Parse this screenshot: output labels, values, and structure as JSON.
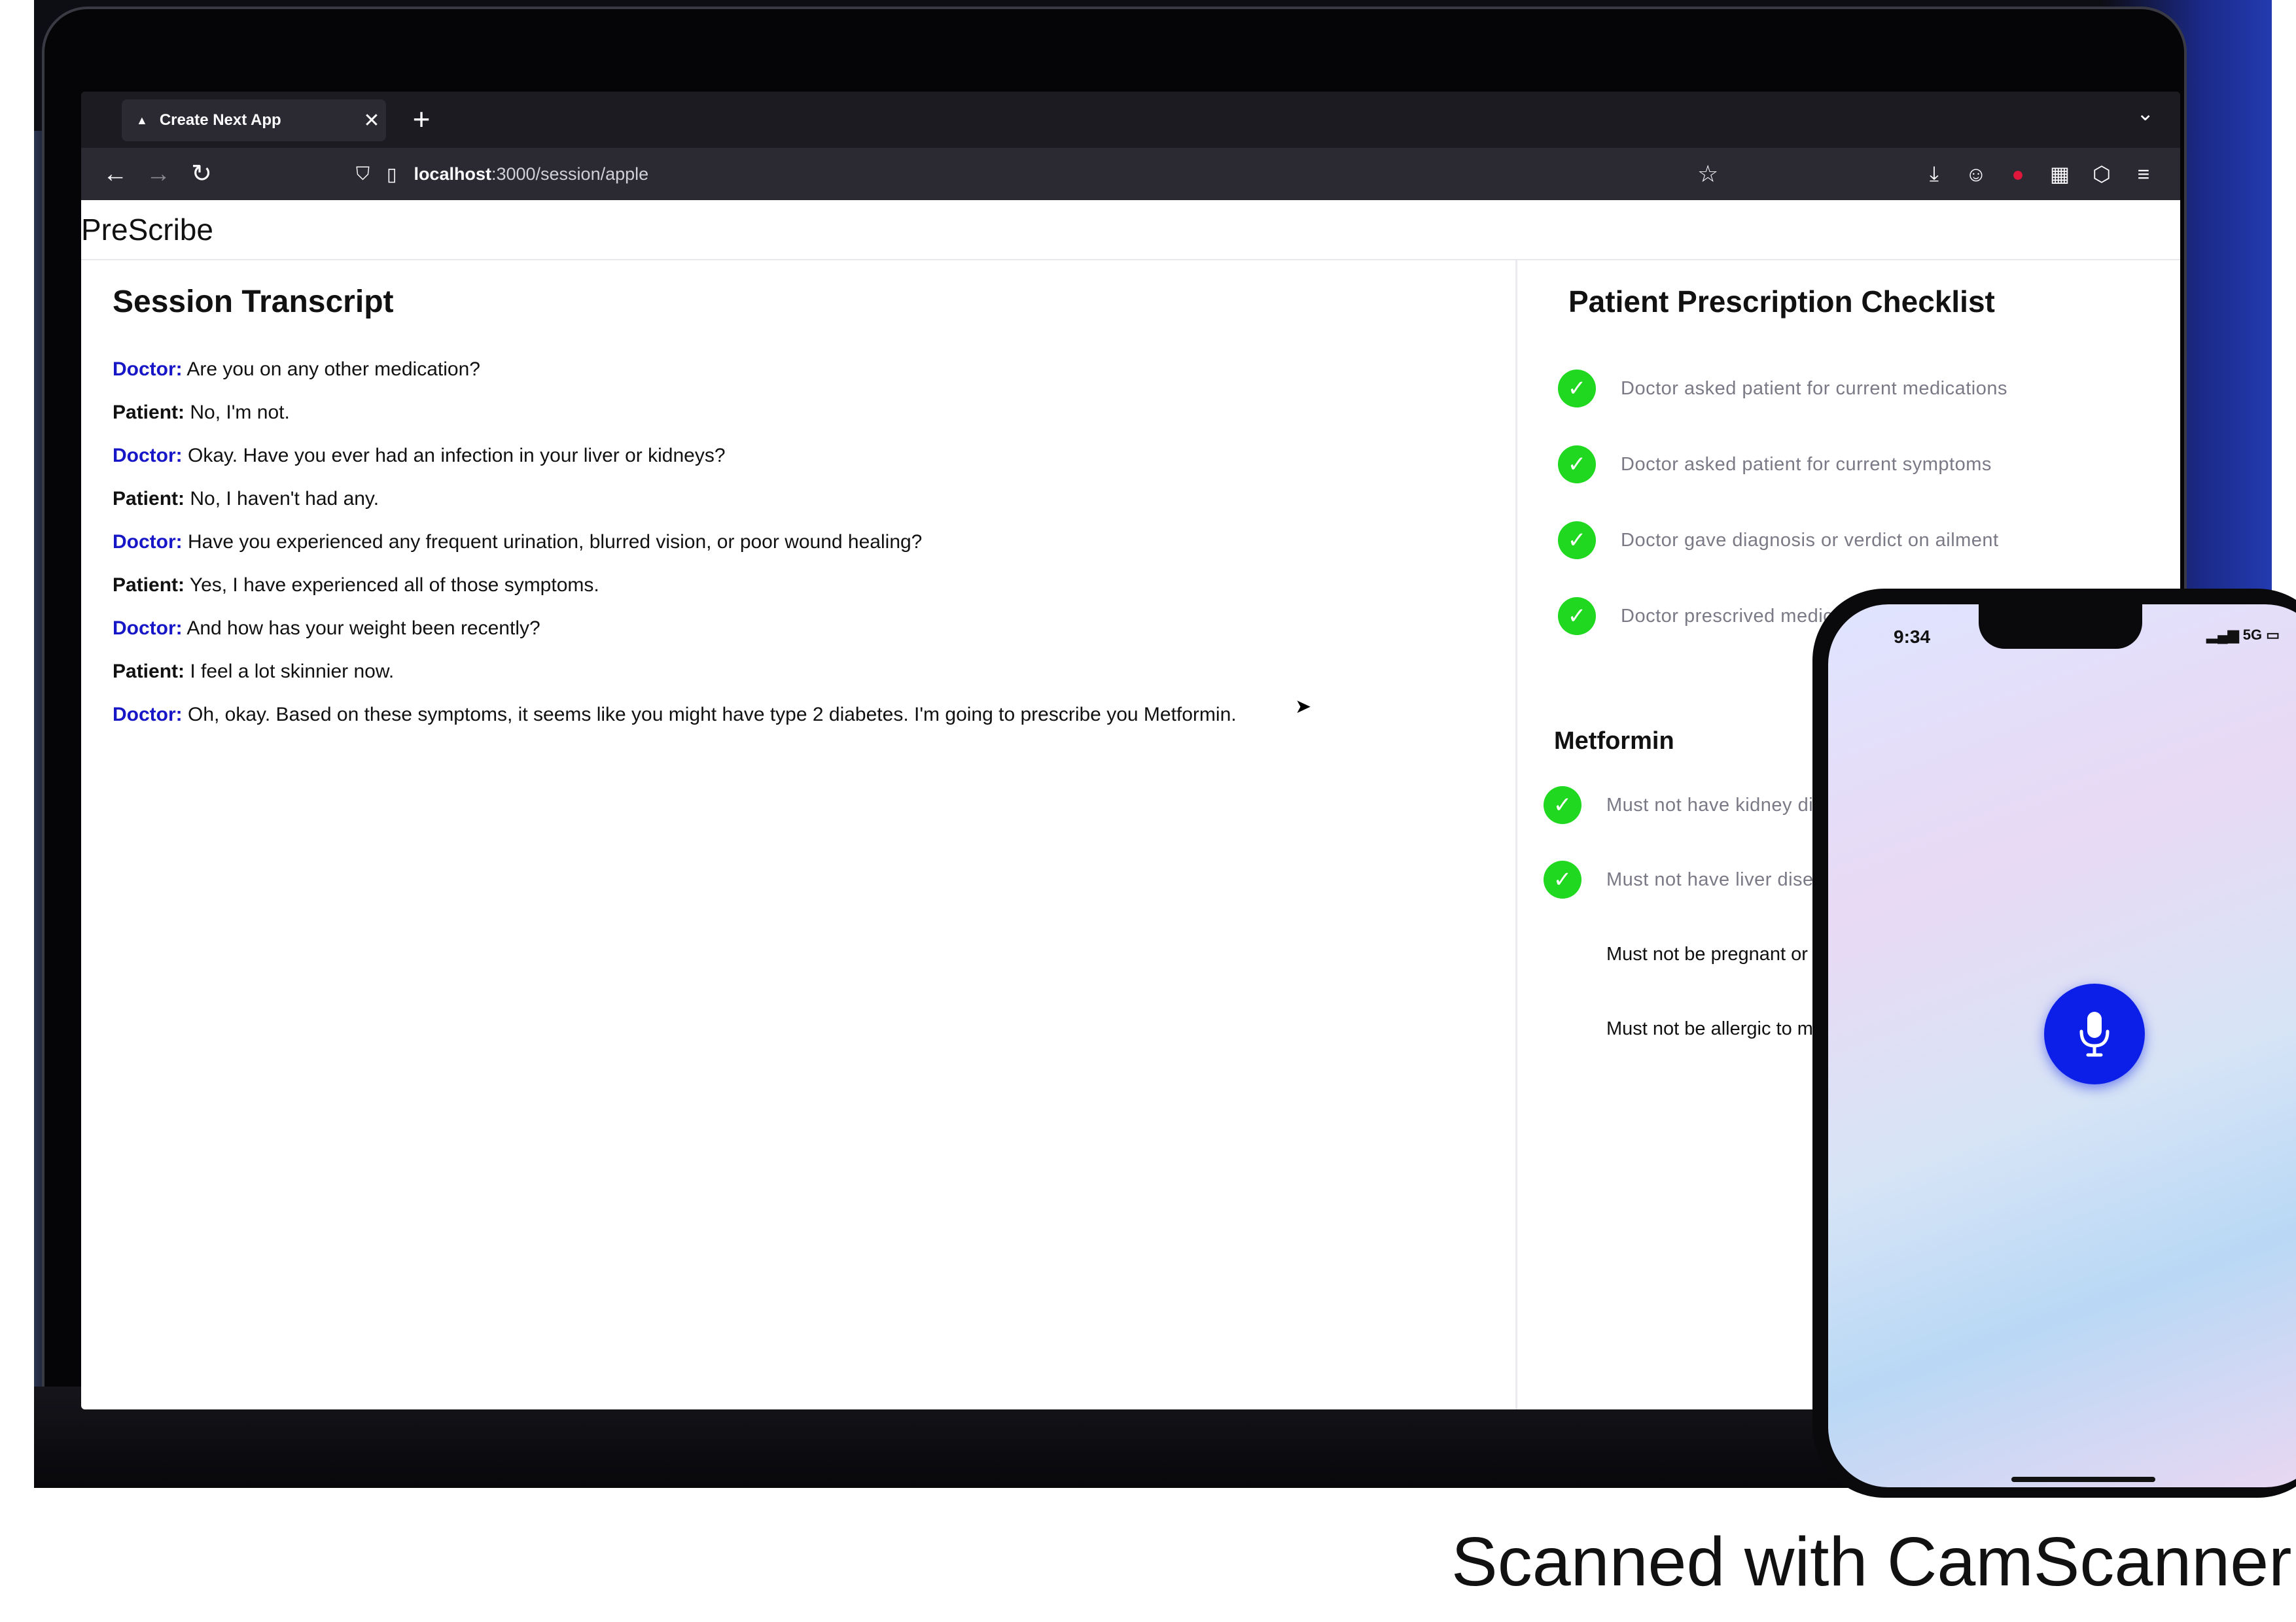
{
  "browser": {
    "tab_title": "Create Next App",
    "tab_close": "✕",
    "new_tab": "+",
    "url_host": "localhost",
    "url_path": ":3000/session/apple"
  },
  "page": {
    "brand": "PreScribe",
    "transcript": {
      "title": "Session Transcript",
      "lines": [
        {
          "speaker": "Doctor:",
          "text": " Are you on any other medication?"
        },
        {
          "speaker": "Patient:",
          "text": " No, I'm not."
        },
        {
          "speaker": "Doctor:",
          "text": " Okay. Have you ever had an infection in your liver or kidneys?"
        },
        {
          "speaker": "Patient:",
          "text": " No, I haven't had any."
        },
        {
          "speaker": "Doctor:",
          "text": " Have you experienced any frequent urination, blurred vision, or poor wound healing?"
        },
        {
          "speaker": "Patient:",
          "text": " Yes, I have experienced all of those symptoms."
        },
        {
          "speaker": "Doctor:",
          "text": " And how has your weight been recently?"
        },
        {
          "speaker": "Patient:",
          "text": " I feel a lot skinnier now."
        },
        {
          "speaker": "Doctor:",
          "text": " Oh, okay. Based on these symptoms, it seems like you might have type 2 diabetes. I'm going to prescribe you Metformin."
        }
      ]
    },
    "checklist": {
      "title": "Patient Prescription Checklist",
      "items": [
        {
          "label": "Doctor asked patient for current medications",
          "checked": true
        },
        {
          "label": "Doctor asked patient for current symptoms",
          "checked": true
        },
        {
          "label": "Doctor gave diagnosis or verdict on ailment",
          "checked": true
        },
        {
          "label": "Doctor prescrived medicatic",
          "checked": true
        }
      ]
    },
    "medication": {
      "name": "Metformin",
      "items": [
        {
          "label": "Must not have kidney di",
          "checked": true
        },
        {
          "label": "Must not have liver disea",
          "checked": true
        },
        {
          "label": "Must not be pregnant or p",
          "checked": false
        },
        {
          "label": "Must not be allergic to me",
          "checked": false
        }
      ]
    }
  },
  "phone": {
    "time": "9:34",
    "network": "5G"
  },
  "watermark": "Scanned with CamScanner",
  "colors": {
    "doctor_label": "#1717c8",
    "check_green": "#1fd81f",
    "mic_blue": "#0c1fe8"
  },
  "icons": [
    "back-icon",
    "forward-icon",
    "reload-icon",
    "shield-icon",
    "page-icon",
    "star-icon",
    "download-icon",
    "account-icon",
    "extension-icon",
    "menu-icon",
    "check-icon",
    "microphone-icon"
  ]
}
